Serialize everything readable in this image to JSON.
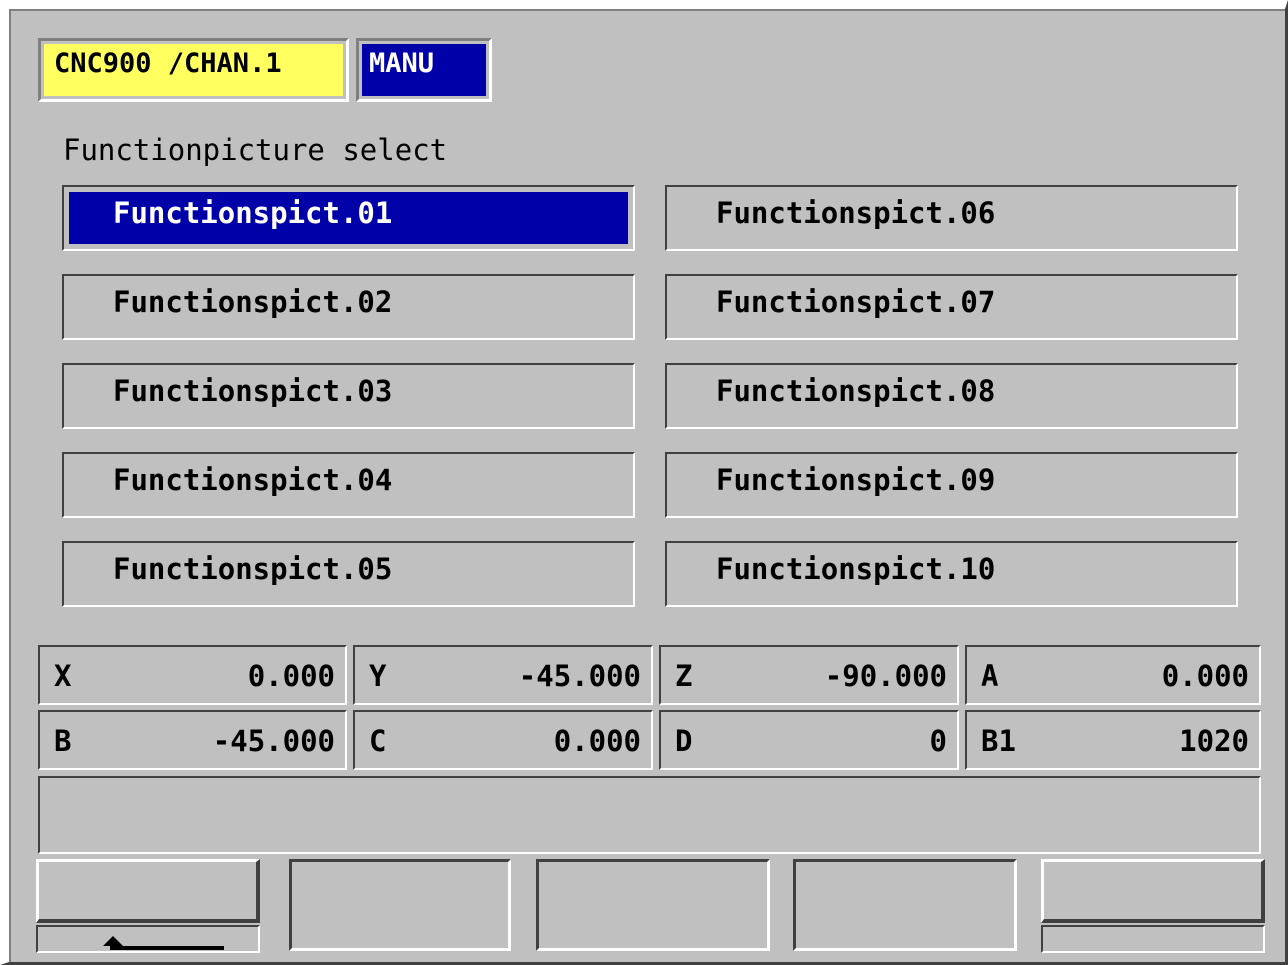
{
  "header": {
    "channel_label": "CNC900 /CHAN.1",
    "mode_label": "MANU",
    "channel_color": "#ffff60",
    "mode_color": "#0000a8"
  },
  "function_select": {
    "title": "Functionpicture select",
    "selected_index": 0,
    "items": [
      {
        "label": "Functionspict.01"
      },
      {
        "label": "Functionspict.02"
      },
      {
        "label": "Functionspict.03"
      },
      {
        "label": "Functionspict.04"
      },
      {
        "label": "Functionspict.05"
      },
      {
        "label": "Functionspict.06"
      },
      {
        "label": "Functionspict.07"
      },
      {
        "label": "Functionspict.08"
      },
      {
        "label": "Functionspict.09"
      },
      {
        "label": "Functionspict.10"
      }
    ]
  },
  "axes": [
    {
      "name": "X",
      "value": "0.000"
    },
    {
      "name": "Y",
      "value": "-45.000"
    },
    {
      "name": "Z",
      "value": "-90.000"
    },
    {
      "name": "A",
      "value": "0.000"
    },
    {
      "name": "B",
      "value": "-45.000"
    },
    {
      "name": "C",
      "value": "0.000"
    },
    {
      "name": "D",
      "value": "0"
    },
    {
      "name": "B1",
      "value": "1020"
    }
  ],
  "message_line": "",
  "softkeys": [
    {
      "label": "",
      "icon": "return-arrow-icon"
    },
    {
      "label": "",
      "icon": ""
    },
    {
      "label": "",
      "icon": ""
    },
    {
      "label": "",
      "icon": ""
    },
    {
      "label": "",
      "icon": ""
    }
  ]
}
